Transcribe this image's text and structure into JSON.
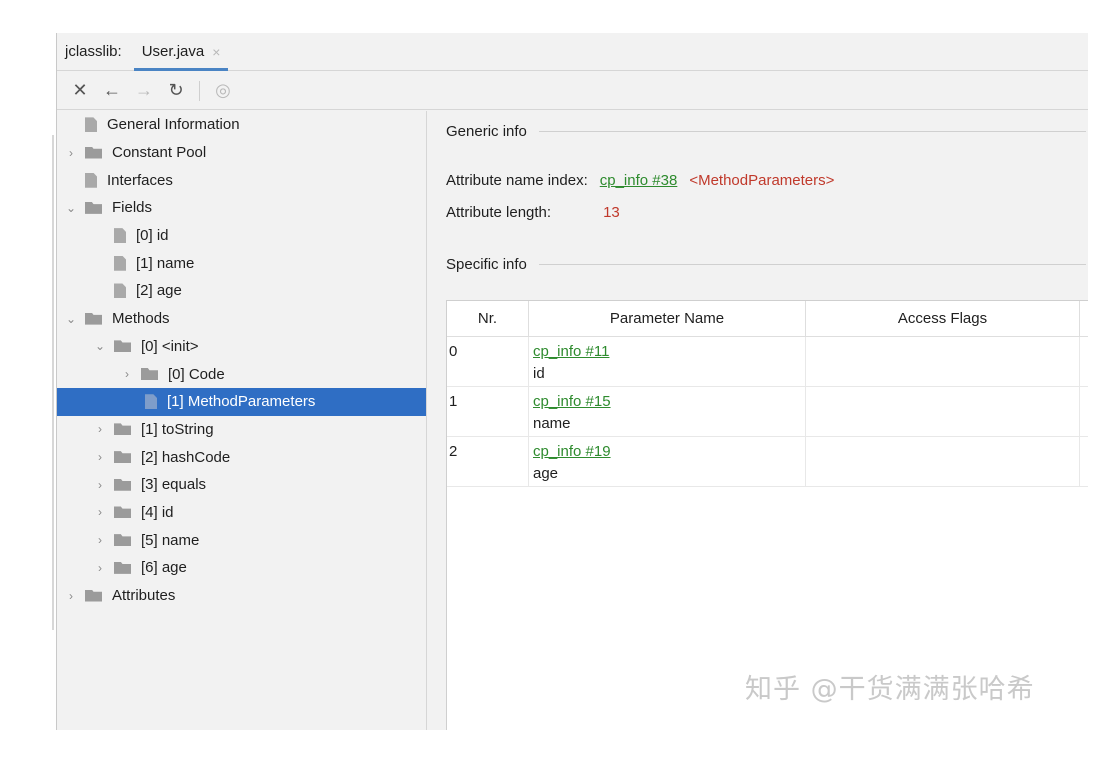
{
  "tabbar": {
    "prefix": "jclasslib:",
    "tab_label": "User.java",
    "tab_close": "×"
  },
  "toolbar": {
    "close": "✕",
    "back": "←",
    "forward": "→",
    "refresh": "↻",
    "browser": "◎"
  },
  "tree": {
    "items": [
      {
        "label": "General Information"
      },
      {
        "label": "Constant Pool"
      },
      {
        "label": "Interfaces"
      },
      {
        "label": "Fields"
      },
      {
        "label": "[0] id"
      },
      {
        "label": "[1] name"
      },
      {
        "label": "[2] age"
      },
      {
        "label": "Methods"
      },
      {
        "label": "[0] <init>"
      },
      {
        "label": "[0] Code"
      },
      {
        "label": "[1] MethodParameters"
      },
      {
        "label": "[1] toString"
      },
      {
        "label": "[2] hashCode"
      },
      {
        "label": "[3] equals"
      },
      {
        "label": "[4] id"
      },
      {
        "label": "[5] name"
      },
      {
        "label": "[6] age"
      },
      {
        "label": "Attributes"
      }
    ]
  },
  "generic": {
    "title": "Generic info",
    "name_index_label": "Attribute name index:",
    "name_index_link": "cp_info #38",
    "name_index_value": "<MethodParameters>",
    "length_label": "Attribute length:",
    "length_value": "13"
  },
  "specific": {
    "title": "Specific info"
  },
  "table": {
    "headers": [
      "Nr.",
      "Parameter Name",
      "Access Flags"
    ],
    "rows": [
      {
        "nr": "0",
        "link": "cp_info #11",
        "name": "id",
        "flags": ""
      },
      {
        "nr": "1",
        "link": "cp_info #15",
        "name": "name",
        "flags": ""
      },
      {
        "nr": "2",
        "link": "cp_info #19",
        "name": "age",
        "flags": ""
      }
    ]
  },
  "watermark": "知乎 @干货满满张哈希"
}
